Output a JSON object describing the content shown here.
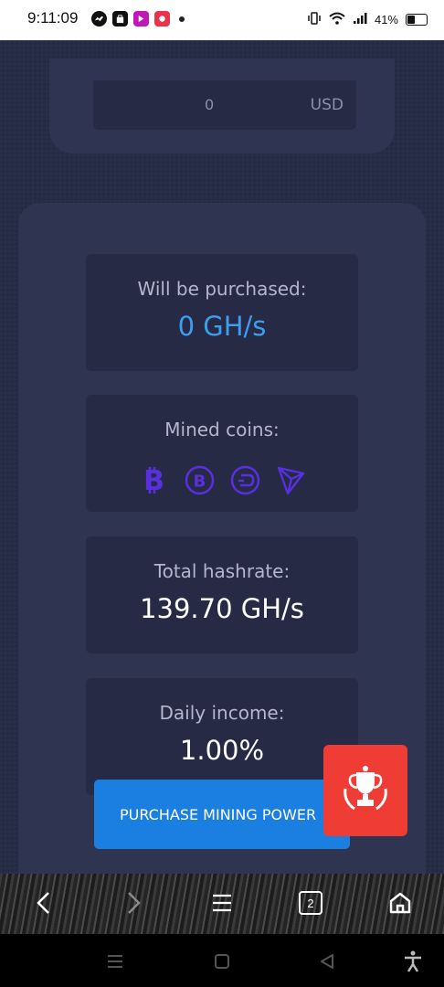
{
  "status_bar": {
    "time": "9:11:09",
    "battery": "41%"
  },
  "calculator": {
    "amount_value": "0",
    "amount_currency": "USD"
  },
  "stats": {
    "purchased_label": "Will be purchased:",
    "purchased_value": "0 GH/s",
    "mined_label": "Mined coins:",
    "mined_coins": [
      "bitcoin-icon",
      "bitcoin-cash-icon",
      "dash-icon",
      "tron-icon"
    ],
    "hashrate_label": "Total hashrate:",
    "hashrate_value": "139.70 GH/s",
    "income_label": "Daily income:",
    "income_value": "1.00%"
  },
  "actions": {
    "purchase_label": "PURCHASE MINING POWER"
  },
  "browser_nav": {
    "tab_count": "2"
  },
  "colors": {
    "accent_blue": "#1a7fe0",
    "value_blue": "#3d9ef0",
    "coin_purple": "#5a2fe0",
    "badge_red": "#ef3d35"
  }
}
